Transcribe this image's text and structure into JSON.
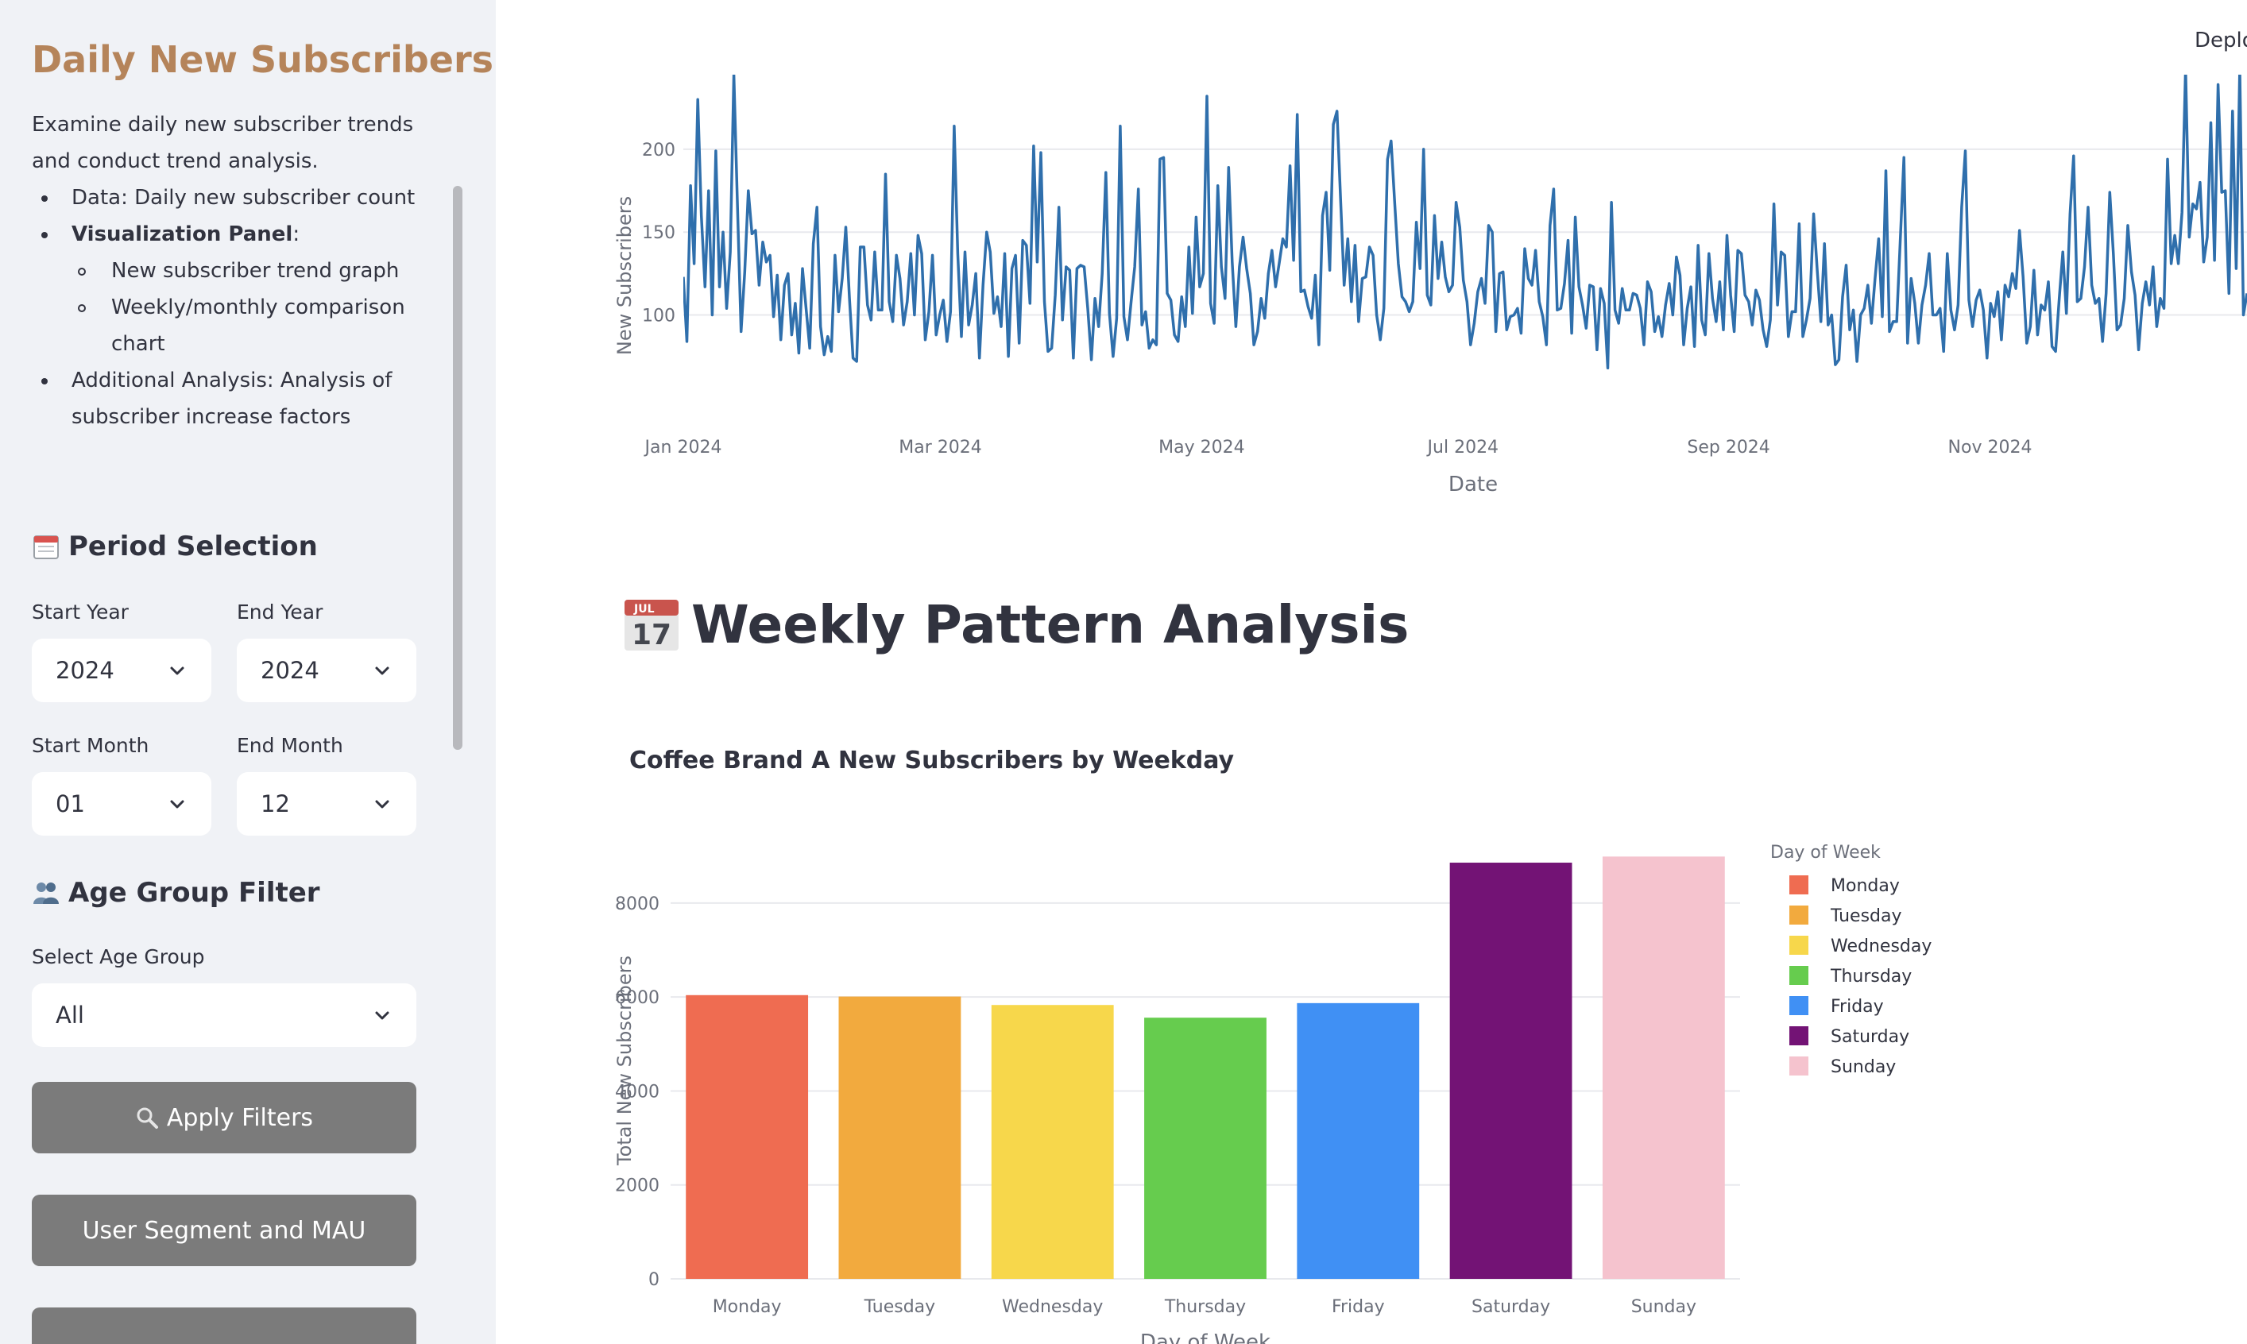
{
  "sidebar": {
    "title": "Daily New Subscribers",
    "intro": "Examine daily new subscriber trends and conduct trend analysis.",
    "bullets": {
      "data": "Data: Daily new subscriber count",
      "viz": "Visualization Panel",
      "viz_colon": ":",
      "sub1": "New subscriber trend graph",
      "sub2": "Weekly/monthly comparison chart",
      "additional": "Additional Analysis: Analysis of subscriber increase factors"
    },
    "period_section": "Period Selection",
    "start_year_label": "Start Year",
    "start_year_value": "2024",
    "end_year_label": "End Year",
    "end_year_value": "2024",
    "start_month_label": "Start Month",
    "start_month_value": "01",
    "end_month_label": "End Month",
    "end_month_value": "12",
    "age_section": "Age Group Filter",
    "age_label": "Select Age Group",
    "age_value": "All",
    "apply_button": "Apply Filters",
    "segment_button": "User Segment and MAU"
  },
  "main": {
    "deploy_label": "Deplo",
    "weekly_heading": "Weekly Pattern Analysis",
    "calendar_icon_month": "JUL",
    "calendar_icon_day": "17",
    "bar_chart_title": "Coffee Brand A New Subscribers by Weekday"
  },
  "colors": {
    "sidebar_title": "#b5845a",
    "line": "#2f6fac",
    "button": "#7b7b7b"
  },
  "chart_data": [
    {
      "type": "line",
      "xlabel": "Date",
      "ylabel": "New Subscribers",
      "x_ticks": [
        "Jan 2024",
        "Mar 2024",
        "May 2024",
        "Jul 2024",
        "Sep 2024",
        "Nov 2024"
      ],
      "y_ticks": [
        100,
        150,
        200
      ],
      "ylim": [
        60,
        245
      ],
      "x_range": [
        "2024-01-01",
        "2024-12-31"
      ],
      "grid": true,
      "series": [
        {
          "values": [
            123,
            84,
            178,
            131,
            230,
            160,
            117,
            175,
            100,
            199,
            117,
            150,
            104,
            138,
            245,
            165,
            90,
            126,
            175,
            149,
            151,
            118,
            144,
            132,
            136,
            99,
            124,
            85,
            118,
            125,
            88,
            107,
            77,
            128,
            104,
            80,
            143,
            165,
            93,
            76,
            87,
            78,
            136,
            102,
            122,
            153,
            110,
            74,
            72,
            141,
            141,
            106,
            97,
            138,
            103,
            103,
            185,
            108,
            96,
            136,
            122,
            94,
            108,
            137,
            100,
            148,
            137,
            85,
            102,
            136,
            88,
            100,
            109,
            84,
            102,
            214,
            137,
            87,
            138,
            94,
            106,
            125,
            74,
            118,
            150,
            138,
            101,
            111,
            93,
            137,
            75,
            128,
            136,
            83,
            145,
            142,
            107,
            202,
            132,
            198,
            108,
            78,
            80,
            112,
            165,
            97,
            129,
            127,
            74,
            128,
            130,
            129,
            104,
            73,
            110,
            93,
            125,
            186,
            101,
            75,
            98,
            214,
            99,
            85,
            108,
            129,
            176,
            94,
            102,
            80,
            85,
            82,
            194,
            195,
            113,
            109,
            88,
            84,
            111,
            93,
            141,
            101,
            159,
            117,
            125,
            232,
            107,
            95,
            178,
            129,
            110,
            189,
            132,
            93,
            129,
            147,
            128,
            113,
            82,
            90,
            110,
            98,
            125,
            139,
            117,
            131,
            146,
            141,
            190,
            133,
            221,
            114,
            115,
            105,
            98,
            124,
            82,
            160,
            174,
            127,
            215,
            223,
            170,
            118,
            146,
            108,
            142,
            96,
            122,
            123,
            141,
            136,
            100,
            85,
            104,
            194,
            205,
            167,
            131,
            111,
            108,
            102,
            108,
            156,
            128,
            200,
            112,
            106,
            160,
            122,
            144,
            123,
            114,
            118,
            168,
            153,
            121,
            108,
            82,
            95,
            114,
            122,
            107,
            154,
            150,
            90,
            125,
            126,
            91,
            99,
            100,
            104,
            89,
            140,
            122,
            118,
            139,
            108,
            99,
            82,
            154,
            176,
            103,
            104,
            119,
            145,
            89,
            159,
            117,
            106,
            92,
            118,
            117,
            79,
            116,
            107,
            68,
            168,
            103,
            95,
            116,
            103,
            103,
            113,
            112,
            104,
            82,
            120,
            114,
            90,
            99,
            87,
            106,
            119,
            100,
            135,
            124,
            82,
            104,
            117,
            81,
            142,
            97,
            88,
            137,
            110,
            96,
            120,
            91,
            148,
            112,
            90,
            139,
            137,
            112,
            108,
            94,
            115,
            109,
            91,
            81,
            97,
            167,
            106,
            138,
            136,
            87,
            102,
            102,
            155,
            87,
            97,
            110,
            161,
            127,
            96,
            143,
            94,
            100,
            70,
            73,
            111,
            130,
            91,
            103,
            72,
            100,
            104,
            118,
            95,
            122,
            146,
            99,
            187,
            90,
            96,
            96,
            146,
            195,
            83,
            122,
            107,
            83,
            106,
            118,
            137,
            100,
            100,
            104,
            78,
            137,
            103,
            91,
            106,
            165,
            199,
            109,
            93,
            109,
            115,
            103,
            74,
            107,
            99,
            114,
            85,
            118,
            111,
            125,
            116,
            151,
            123,
            83,
            93,
            127,
            88,
            106,
            103,
            120,
            81,
            78,
            110,
            138,
            101,
            161,
            196,
            108,
            110,
            129,
            165,
            118,
            107,
            110,
            84,
            113,
            174,
            137,
            91,
            94,
            110,
            154,
            126,
            112,
            79,
            107,
            120,
            106,
            129,
            93,
            110,
            104,
            194,
            131,
            148,
            131,
            162,
            249,
            147,
            167,
            164,
            180,
            132,
            147,
            216,
            133,
            239,
            174,
            175,
            113,
            223,
            128,
            249,
            100,
            113
          ]
        }
      ]
    },
    {
      "type": "bar",
      "title": "Coffee Brand A New Subscribers by Weekday",
      "xlabel": "Day of Week",
      "ylabel": "Total New Subscribers",
      "categories": [
        "Monday",
        "Tuesday",
        "Wednesday",
        "Thursday",
        "Friday",
        "Saturday",
        "Sunday"
      ],
      "values": [
        6040,
        6010,
        5830,
        5560,
        5870,
        8860,
        8990
      ],
      "colors": [
        "#ef6c51",
        "#f2aa3e",
        "#f7d74b",
        "#66cc4e",
        "#4090f4",
        "#731375",
        "#f5c3ce"
      ],
      "ylim": [
        0,
        9300
      ],
      "y_ticks": [
        0,
        2000,
        4000,
        6000,
        8000
      ],
      "legend_title": "Day of Week",
      "legend_position": "right",
      "grid": true
    }
  ]
}
